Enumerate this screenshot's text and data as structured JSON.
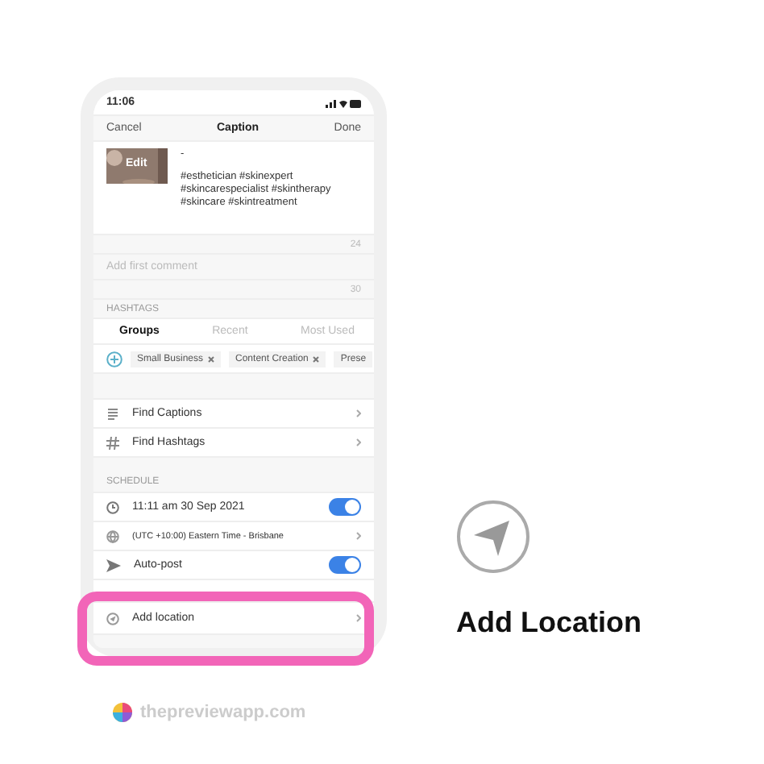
{
  "status_bar": {
    "time": "11:06"
  },
  "nav": {
    "left": "Cancel",
    "title": "Caption",
    "right": "Done"
  },
  "caption": {
    "thumbnail_label": "Edit",
    "lines": [
      "-",
      "#esthetician #skinexpert",
      "#skincarespecialist #skintherapy",
      "#skincare #skintreatment"
    ],
    "count": "24"
  },
  "comment": {
    "placeholder": "Add first comment",
    "count": "30"
  },
  "hashtags": {
    "heading": "HASHTAGS",
    "tabs": [
      {
        "label": "Groups",
        "selected": true
      },
      {
        "label": "Recent",
        "selected": false
      },
      {
        "label": "Most Used",
        "selected": false
      }
    ],
    "chips": [
      "Small Business",
      "Content Creation",
      "Prese"
    ]
  },
  "tools": [
    {
      "kind": "captions",
      "label": "Find Captions"
    },
    {
      "kind": "hashtags",
      "label": "Find Hashtags"
    }
  ],
  "schedule": {
    "heading": "SCHEDULE",
    "rows": [
      {
        "kind": "time",
        "label": "11:11 am  30 Sep 2021",
        "on": true
      },
      {
        "kind": "timezone",
        "label": "(UTC +10:00) Eastern Time - Brisbane"
      },
      {
        "kind": "autopost",
        "label": "Auto-post",
        "on": true
      }
    ]
  },
  "location": {
    "label": "Add location"
  },
  "callout": {
    "title": "Add Location"
  },
  "brand": {
    "text": "thepreviewapp.com"
  }
}
